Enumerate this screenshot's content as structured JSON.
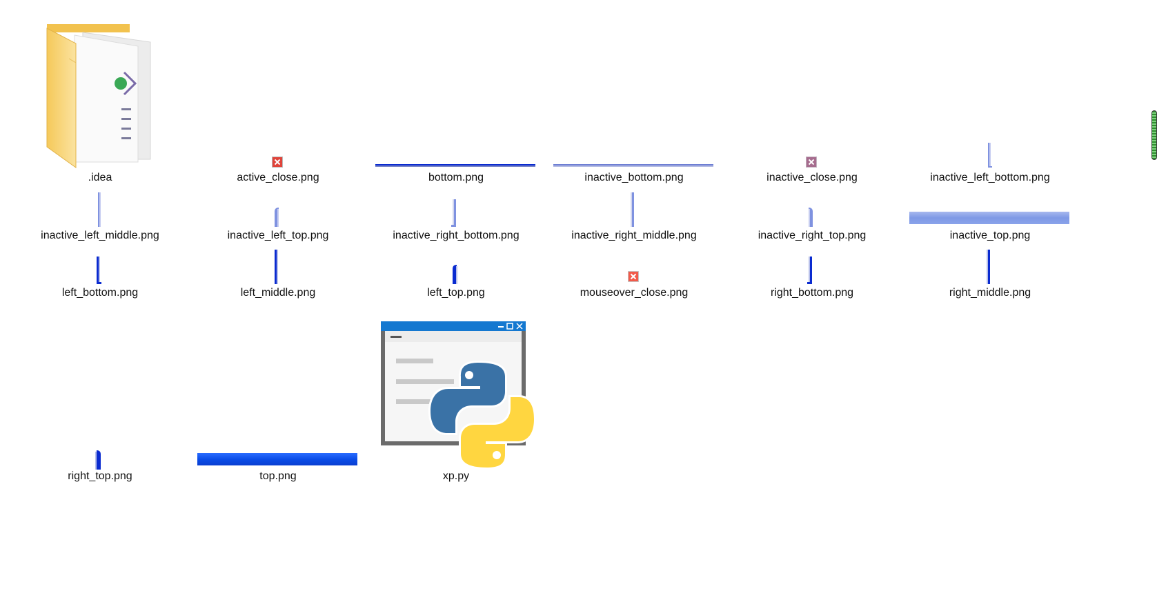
{
  "files": [
    {
      "name": ".idea",
      "icon": "folder-icon"
    },
    {
      "name": "active_close.png",
      "icon": "close-icon"
    },
    {
      "name": "bottom.png",
      "icon": "horizontal-line-icon"
    },
    {
      "name": "inactive_bottom.png",
      "icon": "horizontal-line-icon"
    },
    {
      "name": "inactive_close.png",
      "icon": "close-icon"
    },
    {
      "name": "inactive_left_bottom.png",
      "icon": "vertical-line-icon"
    },
    {
      "name": "inactive_left_middle.png",
      "icon": "vertical-line-icon"
    },
    {
      "name": "inactive_left_top.png",
      "icon": "vertical-line-icon"
    },
    {
      "name": "inactive_right_bottom.png",
      "icon": "vertical-line-icon"
    },
    {
      "name": "inactive_right_middle.png",
      "icon": "vertical-line-icon"
    },
    {
      "name": "inactive_right_top.png",
      "icon": "vertical-line-icon"
    },
    {
      "name": "inactive_top.png",
      "icon": "horizontal-bar-icon"
    },
    {
      "name": "left_bottom.png",
      "icon": "vertical-line-icon"
    },
    {
      "name": "left_middle.png",
      "icon": "vertical-line-icon"
    },
    {
      "name": "left_top.png",
      "icon": "vertical-line-icon"
    },
    {
      "name": "mouseover_close.png",
      "icon": "close-icon"
    },
    {
      "name": "right_bottom.png",
      "icon": "vertical-line-icon"
    },
    {
      "name": "right_middle.png",
      "icon": "vertical-line-icon"
    },
    {
      "name": "right_top.png",
      "icon": "vertical-line-icon"
    },
    {
      "name": "top.png",
      "icon": "horizontal-bar-icon"
    },
    {
      "name": "xp.py",
      "icon": "python-file-icon"
    }
  ],
  "colors": {
    "active_blue": "#0a2bd0",
    "inactive_blue": "#7f92e0",
    "close_red": "#d9302c",
    "close_inactive": "#a0668a",
    "python_blue": "#3a72a6",
    "python_yellow": "#ffd640",
    "window_titlebar": "#1478d0",
    "folder_yellow": "#f7d36e"
  }
}
